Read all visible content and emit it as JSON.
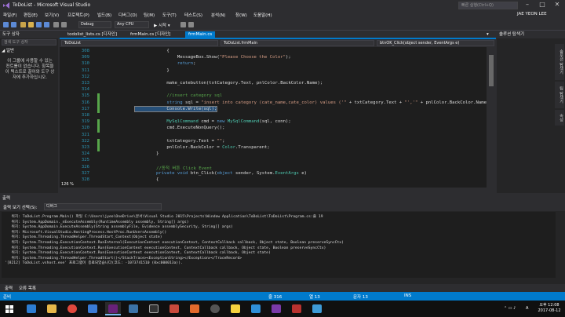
{
  "window": {
    "title": "ToDoList - Microsoft Visual Studio",
    "quick_launch_placeholder": "빠른 실행(Ctrl+Q)",
    "user_name": "JAE YEON LEE"
  },
  "menu": [
    "파일(F)",
    "편집(E)",
    "보기(V)",
    "프로젝트(P)",
    "빌드(B)",
    "디버그(D)",
    "팀(M)",
    "도구(T)",
    "테스트(S)",
    "분석(N)",
    "창(W)",
    "도움말(H)"
  ],
  "toolbar": {
    "config": "Debug",
    "platform": "Any CPU",
    "start_label": "▶ 시작 ▾"
  },
  "toolbox": {
    "header": "도구 상자",
    "search_placeholder": "검색 도구 상자",
    "group": "◢ 일반",
    "empty_message": "이 그룹에 사용할 수 있는 컨트롤이 없습니다. 항목을 이 텍스트로 끌어와 도구 상자에 추가하십시오."
  },
  "tabs": [
    "todolist_lists.cs [디자인]",
    "frmMain.cs [디자인]",
    "frmMain.cs",
    "▾"
  ],
  "active_tab_index": 2,
  "nav": {
    "project": "ToDoList",
    "class": "ToDoList.frmMain",
    "member": "btnOK_Click(object sender, EventArgs e)"
  },
  "code": {
    "lines": [
      {
        "num": "308",
        "segments": [
          {
            "t": "            {",
            "c": ""
          }
        ]
      },
      {
        "num": "309",
        "segments": [
          {
            "t": "                MessageBox.Show(",
            "c": ""
          },
          {
            "t": "\"Please Choose the Color\"",
            "c": "str"
          },
          {
            "t": ");",
            "c": ""
          }
        ]
      },
      {
        "num": "310",
        "segments": [
          {
            "t": "                ",
            "c": ""
          },
          {
            "t": "return",
            "c": "kw"
          },
          {
            "t": ";",
            "c": ""
          }
        ]
      },
      {
        "num": "311",
        "segments": [
          {
            "t": "            }",
            "c": ""
          }
        ]
      },
      {
        "num": "312",
        "segments": [
          {
            "t": "",
            "c": ""
          }
        ]
      },
      {
        "num": "313",
        "segments": [
          {
            "t": "            make_catebutton(txtCategory.Text, pnlColor.BackColor.Name);",
            "c": ""
          }
        ]
      },
      {
        "num": "314",
        "segments": [
          {
            "t": "",
            "c": ""
          }
        ]
      },
      {
        "num": "315",
        "segments": [
          {
            "t": "            ",
            "c": ""
          },
          {
            "t": "//insert category sql",
            "c": "cmt"
          }
        ]
      },
      {
        "num": "316",
        "segments": [
          {
            "t": "            ",
            "c": ""
          },
          {
            "t": "string",
            "c": "kw"
          },
          {
            "t": " sql = ",
            "c": ""
          },
          {
            "t": "\"insert into category (cate_name,cate_color) values ('\"",
            "c": "str"
          },
          {
            "t": " + txtCategory.Text + ",
            "c": ""
          },
          {
            "t": "\"','\"",
            "c": "str"
          },
          {
            "t": " + pnlColor.BackColor.Name + ",
            "c": ""
          },
          {
            "t": "\"')\"",
            "c": "str"
          },
          {
            "t": ";",
            "c": ""
          }
        ]
      },
      {
        "num": "317",
        "segments": [
          {
            "t": "            Console.Write(sql);",
            "c": "sel"
          }
        ]
      },
      {
        "num": "318",
        "segments": [
          {
            "t": "",
            "c": ""
          }
        ]
      },
      {
        "num": "319",
        "segments": [
          {
            "t": "            ",
            "c": ""
          },
          {
            "t": "MySqlCommand",
            "c": "typ"
          },
          {
            "t": " cmd = ",
            "c": ""
          },
          {
            "t": "new",
            "c": "kw"
          },
          {
            "t": " ",
            "c": ""
          },
          {
            "t": "MySqlCommand",
            "c": "typ"
          },
          {
            "t": "(sql, conn);",
            "c": ""
          }
        ]
      },
      {
        "num": "320",
        "segments": [
          {
            "t": "            cmd.ExecuteNonQuery();",
            "c": ""
          }
        ]
      },
      {
        "num": "321",
        "segments": [
          {
            "t": "",
            "c": ""
          }
        ]
      },
      {
        "num": "322",
        "segments": [
          {
            "t": "            txtCategory.Text = ",
            "c": ""
          },
          {
            "t": "\"\"",
            "c": "str"
          },
          {
            "t": ";",
            "c": ""
          }
        ]
      },
      {
        "num": "323",
        "segments": [
          {
            "t": "            pnlColor.BackColor = ",
            "c": ""
          },
          {
            "t": "Color",
            "c": "typ"
          },
          {
            "t": ".Transparent;",
            "c": ""
          }
        ]
      },
      {
        "num": "324",
        "segments": [
          {
            "t": "        }",
            "c": ""
          }
        ]
      },
      {
        "num": "325",
        "segments": [
          {
            "t": "",
            "c": ""
          }
        ]
      },
      {
        "num": "326",
        "segments": [
          {
            "t": "        ",
            "c": ""
          },
          {
            "t": "//동적 버튼 Click Event",
            "c": "cmt"
          }
        ]
      },
      {
        "num": "327",
        "segments": [
          {
            "t": "        ",
            "c": ""
          },
          {
            "t": "private",
            "c": "kw"
          },
          {
            "t": " ",
            "c": ""
          },
          {
            "t": "void",
            "c": "kw"
          },
          {
            "t": " btn_Click(",
            "c": ""
          },
          {
            "t": "object",
            "c": "kw"
          },
          {
            "t": " sender, System.",
            "c": ""
          },
          {
            "t": "EventArgs",
            "c": "typ"
          },
          {
            "t": " e)",
            "c": ""
          }
        ]
      },
      {
        "num": "328",
        "segments": [
          {
            "t": "        {",
            "c": ""
          }
        ]
      }
    ],
    "zoom": "126 %"
  },
  "right_panel": {
    "header": "솔루션 탐색기",
    "side_tabs": [
      "솔루션 탐색기",
      "팀 탐색기",
      "속성"
    ]
  },
  "output": {
    "header": "출력",
    "source_label": "출력 보기 선택(S):",
    "source_value": "디버그",
    "lines": [
      "   위치: ToDoList.Program.Main() 파일 C:\\Users\\jyeo\\OneDrive\\문서\\Visual Studio 2015\\Projects\\Window Application\\ToDoList\\ToDoList\\Program.cs:줄 19",
      "   위치: System.AppDomain._nExecuteAssembly(RuntimeAssembly assembly, String[] args)",
      "   위치: System.AppDomain.ExecuteAssembly(String assemblyFile, Evidence assemblySecurity, String[] args)",
      "   위치: Microsoft.VisualStudio.HostingProcess.HostProc.RunUsersAssembly()",
      "   위치: System.Threading.ThreadHelper.ThreadStart_Context(Object state)",
      "   위치: System.Threading.ExecutionContext.RunInternal(ExecutionContext executionContext, ContextCallback callback, Object state, Boolean preserveSyncCtx)",
      "   위치: System.Threading.ExecutionContext.Run(ExecutionContext executionContext, ContextCallback callback, Object state, Boolean preserveSyncCtx)",
      "   위치: System.Threading.ExecutionContext.Run(ExecutionContext executionContext, ContextCallback callback, Object state)",
      "   위치: System.Threading.ThreadHelper.ThreadStart()</StackTrace><ExceptionString></Exception></TraceRecord>",
      "'[8212] ToDoList.vshost.exe' 프로그램이 종료되었습니다(코드: -1073741510 (0xc000013a))."
    ]
  },
  "bottom_tabs": [
    "출력",
    "오류 목록"
  ],
  "status": {
    "ready": "준비",
    "line": "줄 316",
    "col": "열 13",
    "ch": "문자 13",
    "mode": "INS"
  },
  "taskbar": {
    "time": "오후 12:08",
    "date": "2017-08-12",
    "lang": "A"
  },
  "colors": {
    "accent": "#007acc",
    "editor_bg": "#1e1e1e",
    "chrome_bg": "#2d2d30",
    "vs_purple": "#68217a"
  }
}
